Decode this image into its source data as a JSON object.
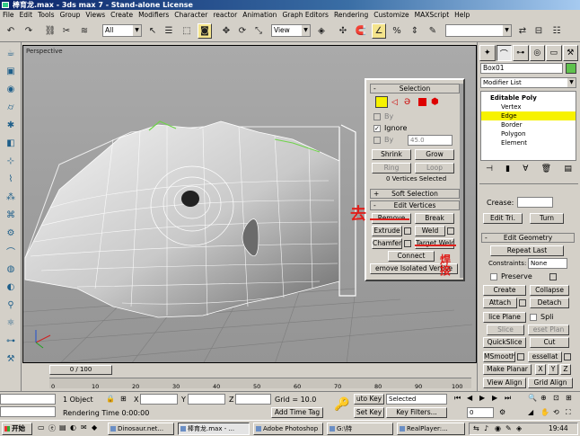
{
  "window": {
    "title": "棒育龙.max - 3ds max 7 - Stand-alone License"
  },
  "menu": [
    "File",
    "Edit",
    "Tools",
    "Group",
    "Views",
    "Create",
    "Modifiers",
    "Character",
    "reactor",
    "Animation",
    "Graph Editors",
    "Rendering",
    "Customize",
    "MAXScript",
    "Help"
  ],
  "toolbar": {
    "selection_filter": "All",
    "coord_system": "View"
  },
  "viewport": {
    "label": "Perspective"
  },
  "command_panel": {
    "object_name": "Box01",
    "modifier_list": "Modifier List",
    "stack": [
      {
        "label": "Editable Poly",
        "level": 0,
        "selected": false
      },
      {
        "label": "Vertex",
        "level": 1,
        "selected": false
      },
      {
        "label": "Edge",
        "level": 1,
        "selected": true
      },
      {
        "label": "Border",
        "level": 1,
        "selected": false
      },
      {
        "label": "Polygon",
        "level": 1,
        "selected": false
      },
      {
        "label": "Element",
        "level": 1,
        "selected": false
      }
    ],
    "crease_label": "Crease:",
    "edit_tri_label": "Edit Tri.",
    "turn_label": "Turn",
    "edit_geometry": {
      "title": "Edit Geometry",
      "repeat_last": "Repeat Last",
      "constraints_label": "Constraints:",
      "constraints_value": "None",
      "preserve_label": "Preserve",
      "create": "Create",
      "collapse": "Collapse",
      "attach": "Attach",
      "detach": "Detach",
      "slice_plane": "lice Plane",
      "split": "Spli",
      "slice": "Slice",
      "reset_plane": "eset Plan",
      "quickslice": "QuickSlice",
      "cut": "Cut",
      "msmooth": "MSmooth",
      "tessellate": "essellat",
      "make_planar": "Make Planar",
      "x": "X",
      "y": "Y",
      "z": "Z",
      "view_align": "View Align",
      "grid_align": "Grid Align"
    }
  },
  "float_panel": {
    "selection_title": "Selection",
    "by_label": "By",
    "ignore_label": "Ignore",
    "by2_label": "By",
    "angle_value": "45.0",
    "shrink": "Shrink",
    "grow": "Grow",
    "ring": "Ring",
    "loop": "Loop",
    "status": "0 Vertices Selected",
    "soft_selection": "Soft Selection",
    "edit_vertices": "Edit Vertices",
    "remove": "Remove",
    "break": "Break",
    "extrude": "Extrude",
    "weld": "Weld",
    "chamfer": "Chamfer",
    "target_weld": "Target Weld",
    "connect": "Connect",
    "remove_isolated": "emove Isolated Vertice"
  },
  "annotations": {
    "remove_note": "去",
    "weld_note": "焊\n接"
  },
  "timeline": {
    "frame": "0 / 100",
    "ticks": [
      "0",
      "10",
      "20",
      "30",
      "40",
      "50",
      "60",
      "70",
      "80",
      "90",
      "100"
    ]
  },
  "status": {
    "object_count": "1 Object",
    "x_label": "X",
    "y_label": "Y",
    "z_label": "Z",
    "grid": "Grid = 10.0",
    "rendering_time": "Rendering Time  0:00:00",
    "add_time_tag": "Add Time Tag",
    "auto_key": "uto Key",
    "set_key": "Set Key",
    "selected": "Selected",
    "key_filters": "Key Filters...",
    "frame_value": "0"
  },
  "taskbar": {
    "start": "开始",
    "tasks": [
      {
        "label": "Dinosaur.net...",
        "active": false
      },
      {
        "label": "棒育龙.max - ...",
        "active": true
      },
      {
        "label": "Adobe Photoshop",
        "active": false
      },
      {
        "label": "G:\\特",
        "active": false
      },
      {
        "label": "RealPlayer:...",
        "active": false
      }
    ],
    "clock": "19:44"
  },
  "colors": {
    "selected_stack": "#f7f200",
    "annotation": "#e0201c",
    "object_color": "#5fc24d"
  }
}
